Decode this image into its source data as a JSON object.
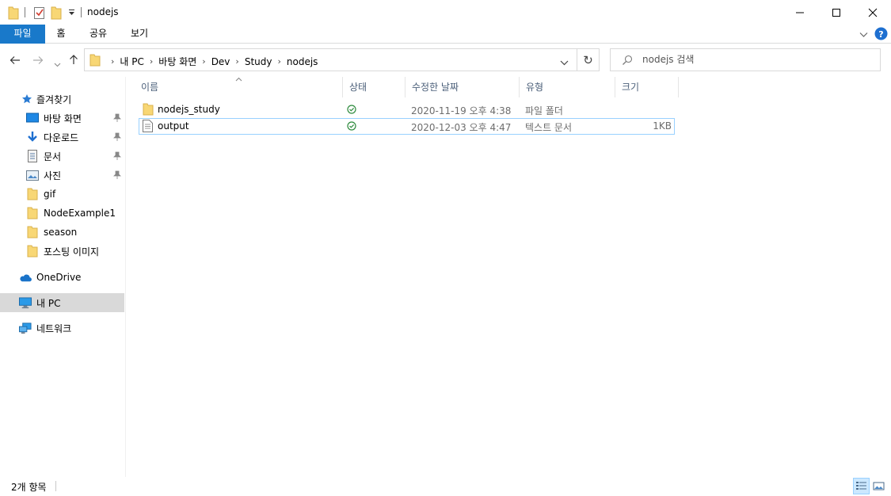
{
  "window": {
    "title": "nodejs"
  },
  "ribbon": {
    "tabs": [
      "파일",
      "홈",
      "공유",
      "보기"
    ]
  },
  "address": {
    "crumbs": [
      "내 PC",
      "바탕 화면",
      "Dev",
      "Study",
      "nodejs"
    ]
  },
  "search": {
    "placeholder": "nodejs 검색"
  },
  "navpane": {
    "quick_access": "즐겨찾기",
    "pinned": [
      "바탕 화면",
      "다운로드",
      "문서",
      "사진"
    ],
    "folders": [
      "gif",
      "NodeExample1",
      "season",
      "포스팅 이미지"
    ],
    "onedrive": "OneDrive",
    "thispc": "내 PC",
    "network": "네트워크"
  },
  "columns": {
    "name": "이름",
    "status": "상태",
    "date": "수정한 날짜",
    "type": "유형",
    "size": "크기"
  },
  "files": [
    {
      "name": "nodejs_study",
      "date": "2020-11-19 오후 4:38",
      "type": "파일 폴더",
      "size": ""
    },
    {
      "name": "output",
      "date": "2020-12-03 오후 4:47",
      "type": "텍스트 문서",
      "size": "1KB"
    }
  ],
  "statusbar": {
    "count": "2개 항목"
  },
  "colors": {
    "accent": "#1979ca",
    "folder": "#f8d775",
    "selection": "#cce8ff",
    "sync_ok": "#2e8b3d"
  }
}
